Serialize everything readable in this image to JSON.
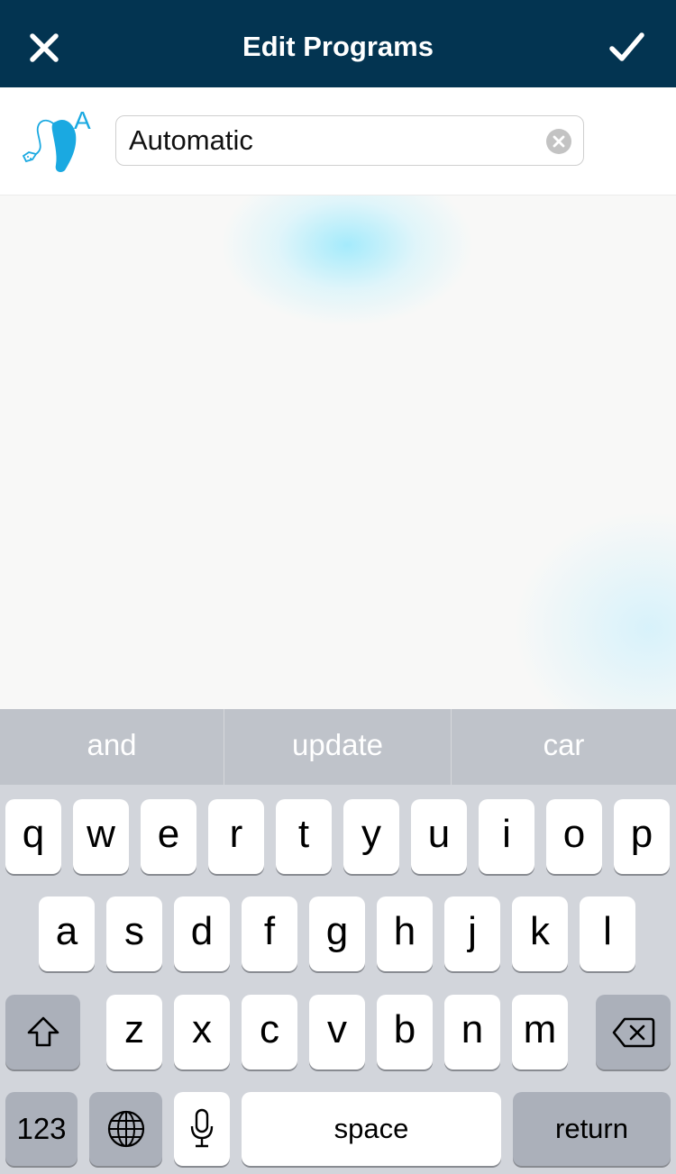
{
  "navbar": {
    "title": "Edit Programs",
    "close_icon": "close-x-icon",
    "done_icon": "checkmark-icon",
    "background": "#033451"
  },
  "program": {
    "icon": "hearing-aid-automatic-icon",
    "icon_letter": "A",
    "icon_color": "#1aa9e1",
    "name_value": "Automatic",
    "clear_icon": "clear-circle-icon"
  },
  "keyboard": {
    "suggestions": [
      "and",
      "update",
      "car"
    ],
    "rows": [
      [
        "q",
        "w",
        "e",
        "r",
        "t",
        "y",
        "u",
        "i",
        "o",
        "p"
      ],
      [
        "a",
        "s",
        "d",
        "f",
        "g",
        "h",
        "j",
        "k",
        "l"
      ],
      [
        "z",
        "x",
        "c",
        "v",
        "b",
        "n",
        "m"
      ]
    ],
    "shift_icon": "shift-arrow-icon",
    "delete_icon": "backspace-icon",
    "numbers_label": "123",
    "globe_icon": "globe-icon",
    "mic_icon": "microphone-icon",
    "space_label": "space",
    "return_label": "return"
  }
}
